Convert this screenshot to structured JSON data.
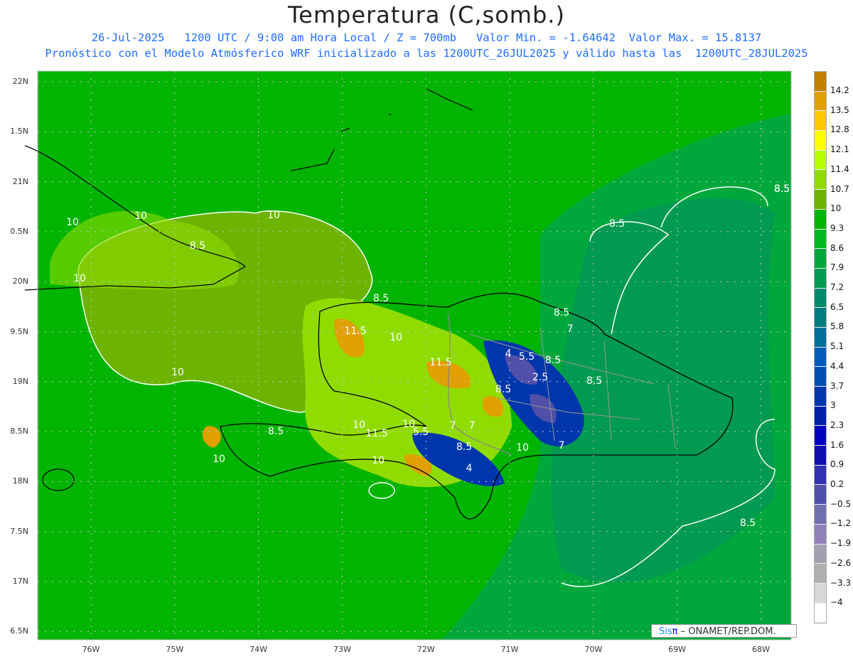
{
  "title": "Temperatura (C,somb.)",
  "subtitle_line1": "26-Jul-2025   1200 UTC / 9:00 am Hora Local / Z = 700mb   Valor Min. = -1.64642  Valor Max. = 15.8137",
  "subtitle_line2": "Pronóstico con el Modelo Atmósferico WRF inicializado a las 1200UTC_26JUL2025 y válido hasta las  1200UTC_28JUL2025",
  "credit": {
    "sis": "Sis",
    "pi": "π",
    "org": " – ONAMET/REP.DOM."
  },
  "lat_ticks": [
    "22N",
    "1.5N",
    "21N",
    "0.5N",
    "20N",
    "9.5N",
    "19N",
    "8.5N",
    "18N",
    "7.5N",
    "17N",
    "6.5N"
  ],
  "lon_ticks": [
    "76W",
    "75W",
    "74W",
    "73W",
    "72W",
    "71W",
    "70W",
    "69W",
    "68W"
  ],
  "colorbar": {
    "labels": [
      "14.2",
      "13.5",
      "12.8",
      "12.1",
      "11.4",
      "10.7",
      "10",
      "9.3",
      "8.6",
      "7.9",
      "7.2",
      "6.5",
      "5.8",
      "5.1",
      "4.4",
      "3.7",
      "3",
      "2.3",
      "1.6",
      "0.9",
      "0.2",
      "−0.5",
      "−1.2",
      "−1.9",
      "−2.6",
      "−3.3",
      "−4"
    ],
    "colors": [
      "#c08000",
      "#e0a000",
      "#ffc800",
      "#ffff00",
      "#b8ff00",
      "#90dc00",
      "#6cb400",
      "#00b400",
      "#00b820",
      "#00a83c",
      "#009a50",
      "#008a6c",
      "#007c80",
      "#006e9a",
      "#005cb8",
      "#0050b4",
      "#0036ac",
      "#0020a8",
      "#0000c0",
      "#1010b0",
      "#3030b0",
      "#5050a8",
      "#7070b0",
      "#9080b8",
      "#a0a0b0",
      "#b0b0b0",
      "#d8d8d8",
      "#ffffff"
    ]
  },
  "contour_labels": [
    "10",
    "10",
    "10",
    "10",
    "10",
    "8.5",
    "10",
    "8.5",
    "8.5",
    "11.5",
    "10",
    "8.5",
    "4",
    "5.5",
    "8.5",
    "7",
    "11.5",
    "2.5",
    "8.5",
    "8.5",
    "7",
    "10",
    "11.5",
    "10",
    "5.5",
    "7",
    "8.5",
    "10",
    "7",
    "4",
    "10",
    "8.5",
    "8.5",
    "8.5",
    "8.5"
  ]
}
